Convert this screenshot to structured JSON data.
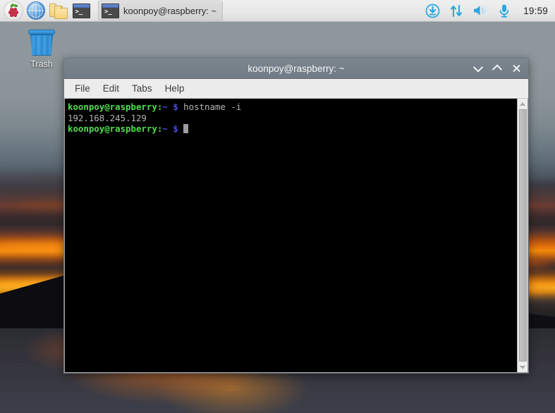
{
  "taskbar": {
    "launchers": [
      {
        "name": "raspberry-menu",
        "label": "Menu"
      },
      {
        "name": "web-browser",
        "label": "Web Browser"
      },
      {
        "name": "file-manager",
        "label": "File Manager"
      },
      {
        "name": "terminal",
        "label": "Terminal"
      }
    ],
    "window_button": {
      "label": "koonpoy@raspberry: ~"
    },
    "tray": [
      {
        "name": "updates-icon",
        "label": "Updates"
      },
      {
        "name": "network-icon",
        "label": "Network"
      },
      {
        "name": "volume-icon",
        "label": "Volume"
      },
      {
        "name": "microphone-icon",
        "label": "Microphone"
      }
    ],
    "clock": "19:59"
  },
  "desktop": {
    "trash": {
      "label": "Trash"
    }
  },
  "terminal": {
    "title": "koonpoy@raspberry: ~",
    "menu": [
      "File",
      "Edit",
      "Tabs",
      "Help"
    ],
    "window_controls": {
      "minimize": "minimize",
      "maximize": "maximize",
      "close": "close"
    },
    "prompt": {
      "user_host": "koonpoy@raspberry",
      "colon": ":",
      "path": "~",
      "symbol": "$"
    },
    "lines": [
      {
        "type": "prompt-command",
        "command": "hostname -i"
      },
      {
        "type": "output",
        "text": "192.168.245.129"
      },
      {
        "type": "prompt-cursor"
      }
    ]
  },
  "colors": {
    "prompt_green": "#4be04b",
    "prompt_blue": "#4a4ae8",
    "terminal_bg": "#000000",
    "terminal_fg": "#b2b2b2",
    "titlebar": "#717b85",
    "taskbar": "#e9e9e9",
    "tray_accent": "#29a8e0"
  }
}
